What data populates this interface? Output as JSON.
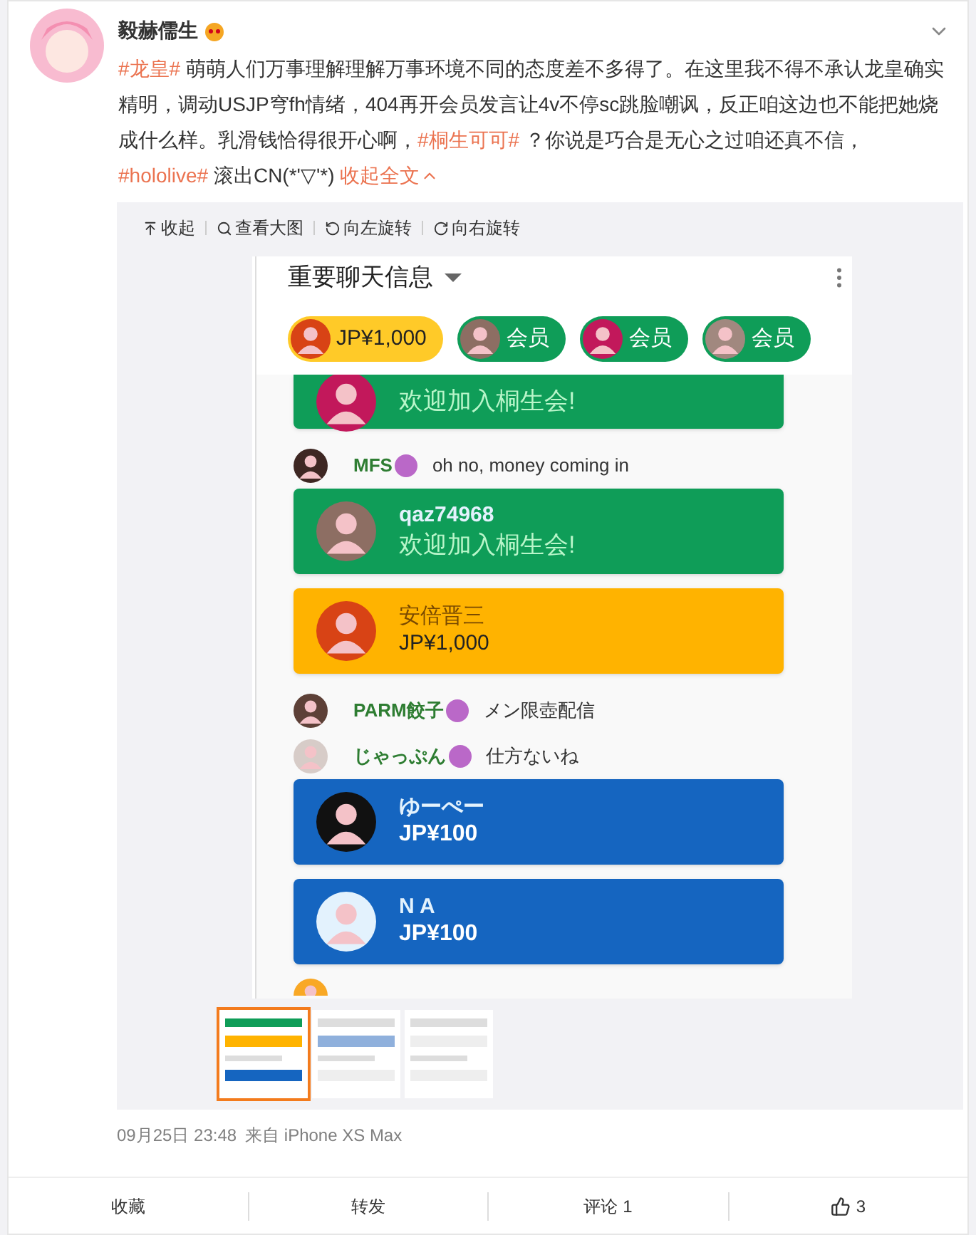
{
  "post": {
    "author": "毅赫儒生",
    "text": [
      {
        "kind": "tag",
        "text": "#龙皇#"
      },
      {
        "kind": "text",
        "text": " 萌萌人们万事理解理解万事环境不同的态度差不多得了。在这里我不得不承认龙皇确实精明，调动USJP穹fh情绪，404再开会员发言让4v不停sc跳脸嘲讽，反正咱这边也不能把她烧成什么样。乳滑钱恰得很开心啊，"
      },
      {
        "kind": "tag",
        "text": "#桐生可可#"
      },
      {
        "kind": "text",
        "text": " ？你说是巧合是无心之过咱还真不信，"
      },
      {
        "kind": "tag",
        "text": "#hololive#"
      },
      {
        "kind": "text",
        "text": " 滚出CN(*'▽'*) "
      },
      {
        "kind": "link",
        "text": "收起全文"
      }
    ],
    "time": "09月25日 23:48",
    "source": "来自 iPhone XS Max"
  },
  "viewer": {
    "toolbar": [
      "收起",
      "查看大图",
      "向左旋转",
      "向右旋转"
    ]
  },
  "chat": {
    "title": "重要聊天信息",
    "tickers": [
      {
        "kind": "paid",
        "text": "JP¥1,000",
        "color": "#ffca28"
      },
      {
        "kind": "member",
        "text": "会员",
        "color": "#0f9d58"
      },
      {
        "kind": "member",
        "text": "会员",
        "color": "#0f9d58"
      },
      {
        "kind": "member",
        "text": "会员",
        "color": "#0f9d58"
      }
    ],
    "messages": [
      {
        "kind": "card",
        "color": "#0f9d58",
        "line2": "欢迎加入桐生会!",
        "partial": true
      },
      {
        "kind": "text",
        "author": "MFS",
        "text": "oh no, money coming in"
      },
      {
        "kind": "card",
        "color": "#0f9d58",
        "line1": "qaz74968",
        "line2": "欢迎加入桐生会!"
      },
      {
        "kind": "card",
        "color": "#ffb300",
        "line1": "安倍晋三",
        "line2": "JP¥1,000"
      },
      {
        "kind": "text",
        "author": "PARM餃子",
        "text": "メン限壺配信"
      },
      {
        "kind": "text",
        "author": "じゃっぷん",
        "text": "仕方ないね"
      },
      {
        "kind": "card",
        "color": "#1565c0",
        "line1": "ゆーぺー",
        "line2": "JP¥100"
      },
      {
        "kind": "card",
        "color": "#1565c0",
        "line1": "N A",
        "line2": "JP¥100"
      },
      {
        "kind": "cut"
      }
    ]
  },
  "thumbnails": [
    {
      "selected": true
    },
    {
      "selected": false
    },
    {
      "selected": false
    }
  ],
  "actions": [
    {
      "kind": "text",
      "text": "收藏"
    },
    {
      "kind": "text",
      "text": "转发"
    },
    {
      "kind": "text",
      "text": "评论 1"
    },
    {
      "kind": "like",
      "text": "3"
    }
  ]
}
